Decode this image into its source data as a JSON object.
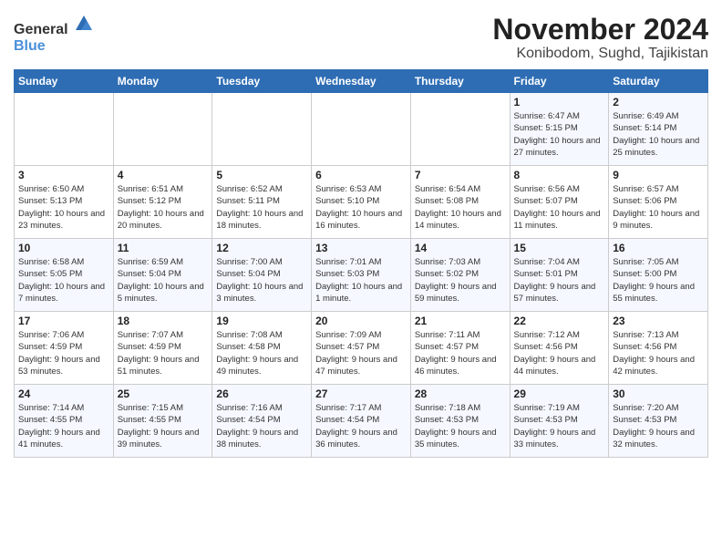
{
  "header": {
    "logo_general": "General",
    "logo_blue": "Blue",
    "month_title": "November 2024",
    "location": "Konibodom, Sughd, Tajikistan"
  },
  "weekdays": [
    "Sunday",
    "Monday",
    "Tuesday",
    "Wednesday",
    "Thursday",
    "Friday",
    "Saturday"
  ],
  "weeks": [
    [
      {
        "day": "",
        "info": ""
      },
      {
        "day": "",
        "info": ""
      },
      {
        "day": "",
        "info": ""
      },
      {
        "day": "",
        "info": ""
      },
      {
        "day": "",
        "info": ""
      },
      {
        "day": "1",
        "info": "Sunrise: 6:47 AM\nSunset: 5:15 PM\nDaylight: 10 hours and 27 minutes."
      },
      {
        "day": "2",
        "info": "Sunrise: 6:49 AM\nSunset: 5:14 PM\nDaylight: 10 hours and 25 minutes."
      }
    ],
    [
      {
        "day": "3",
        "info": "Sunrise: 6:50 AM\nSunset: 5:13 PM\nDaylight: 10 hours and 23 minutes."
      },
      {
        "day": "4",
        "info": "Sunrise: 6:51 AM\nSunset: 5:12 PM\nDaylight: 10 hours and 20 minutes."
      },
      {
        "day": "5",
        "info": "Sunrise: 6:52 AM\nSunset: 5:11 PM\nDaylight: 10 hours and 18 minutes."
      },
      {
        "day": "6",
        "info": "Sunrise: 6:53 AM\nSunset: 5:10 PM\nDaylight: 10 hours and 16 minutes."
      },
      {
        "day": "7",
        "info": "Sunrise: 6:54 AM\nSunset: 5:08 PM\nDaylight: 10 hours and 14 minutes."
      },
      {
        "day": "8",
        "info": "Sunrise: 6:56 AM\nSunset: 5:07 PM\nDaylight: 10 hours and 11 minutes."
      },
      {
        "day": "9",
        "info": "Sunrise: 6:57 AM\nSunset: 5:06 PM\nDaylight: 10 hours and 9 minutes."
      }
    ],
    [
      {
        "day": "10",
        "info": "Sunrise: 6:58 AM\nSunset: 5:05 PM\nDaylight: 10 hours and 7 minutes."
      },
      {
        "day": "11",
        "info": "Sunrise: 6:59 AM\nSunset: 5:04 PM\nDaylight: 10 hours and 5 minutes."
      },
      {
        "day": "12",
        "info": "Sunrise: 7:00 AM\nSunset: 5:04 PM\nDaylight: 10 hours and 3 minutes."
      },
      {
        "day": "13",
        "info": "Sunrise: 7:01 AM\nSunset: 5:03 PM\nDaylight: 10 hours and 1 minute."
      },
      {
        "day": "14",
        "info": "Sunrise: 7:03 AM\nSunset: 5:02 PM\nDaylight: 9 hours and 59 minutes."
      },
      {
        "day": "15",
        "info": "Sunrise: 7:04 AM\nSunset: 5:01 PM\nDaylight: 9 hours and 57 minutes."
      },
      {
        "day": "16",
        "info": "Sunrise: 7:05 AM\nSunset: 5:00 PM\nDaylight: 9 hours and 55 minutes."
      }
    ],
    [
      {
        "day": "17",
        "info": "Sunrise: 7:06 AM\nSunset: 4:59 PM\nDaylight: 9 hours and 53 minutes."
      },
      {
        "day": "18",
        "info": "Sunrise: 7:07 AM\nSunset: 4:59 PM\nDaylight: 9 hours and 51 minutes."
      },
      {
        "day": "19",
        "info": "Sunrise: 7:08 AM\nSunset: 4:58 PM\nDaylight: 9 hours and 49 minutes."
      },
      {
        "day": "20",
        "info": "Sunrise: 7:09 AM\nSunset: 4:57 PM\nDaylight: 9 hours and 47 minutes."
      },
      {
        "day": "21",
        "info": "Sunrise: 7:11 AM\nSunset: 4:57 PM\nDaylight: 9 hours and 46 minutes."
      },
      {
        "day": "22",
        "info": "Sunrise: 7:12 AM\nSunset: 4:56 PM\nDaylight: 9 hours and 44 minutes."
      },
      {
        "day": "23",
        "info": "Sunrise: 7:13 AM\nSunset: 4:56 PM\nDaylight: 9 hours and 42 minutes."
      }
    ],
    [
      {
        "day": "24",
        "info": "Sunrise: 7:14 AM\nSunset: 4:55 PM\nDaylight: 9 hours and 41 minutes."
      },
      {
        "day": "25",
        "info": "Sunrise: 7:15 AM\nSunset: 4:55 PM\nDaylight: 9 hours and 39 minutes."
      },
      {
        "day": "26",
        "info": "Sunrise: 7:16 AM\nSunset: 4:54 PM\nDaylight: 9 hours and 38 minutes."
      },
      {
        "day": "27",
        "info": "Sunrise: 7:17 AM\nSunset: 4:54 PM\nDaylight: 9 hours and 36 minutes."
      },
      {
        "day": "28",
        "info": "Sunrise: 7:18 AM\nSunset: 4:53 PM\nDaylight: 9 hours and 35 minutes."
      },
      {
        "day": "29",
        "info": "Sunrise: 7:19 AM\nSunset: 4:53 PM\nDaylight: 9 hours and 33 minutes."
      },
      {
        "day": "30",
        "info": "Sunrise: 7:20 AM\nSunset: 4:53 PM\nDaylight: 9 hours and 32 minutes."
      }
    ]
  ]
}
